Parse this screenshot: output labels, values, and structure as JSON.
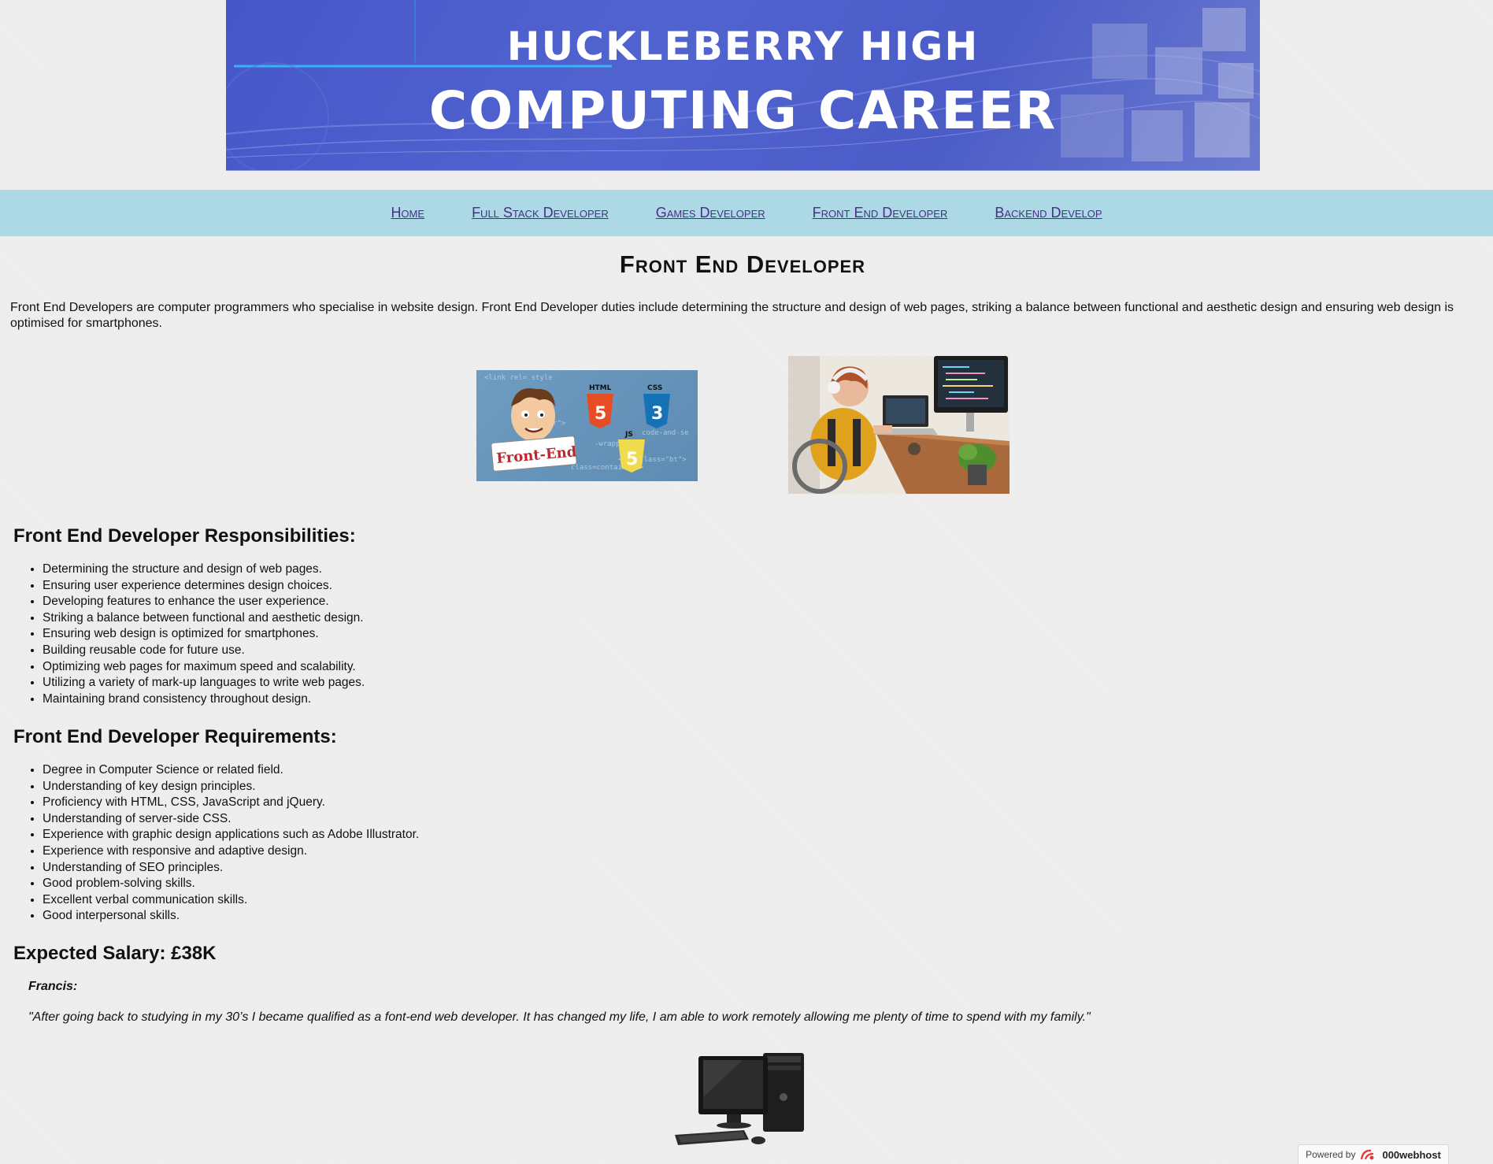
{
  "banner": {
    "line1": "HUCKLEBERRY HIGH",
    "line2": "COMPUTING CAREER",
    "colors": {
      "background": "#4b5cc7",
      "text": "#ffffff"
    }
  },
  "nav": {
    "items": [
      {
        "label": "Home"
      },
      {
        "label": "Full Stack Developer"
      },
      {
        "label": "Games Developer"
      },
      {
        "label": "Front End Developer"
      },
      {
        "label": "Backend Develop"
      }
    ],
    "colors": {
      "background": "#add8e6",
      "link": "#2c2ca0",
      "visited": "#4a2e86"
    }
  },
  "page": {
    "title": "Front End Developer",
    "intro": "Front End Developers are computer programmers who specialise in website design. Front End Developer duties include determining the structure and design of web pages, striking a balance between functional and aesthetic design and ensuring web design is optimised for smartphones."
  },
  "images": {
    "frontend": {
      "badge_text": "Front-End",
      "html_label": "HTML",
      "css_label": "CSS",
      "js_label": "JS",
      "html_num": "5",
      "css_num": "3",
      "js_num": "5",
      "code_lines": [
        "<link rel= style",
        "banner\">",
        "-wrapper\">",
        "class=container\">",
        "<div class=\"bt\">",
        "code-and-se"
      ]
    },
    "developer_photo": {
      "icon": "developer-at-desk-photo"
    },
    "computer": {
      "icon": "desktop-computer-icon"
    }
  },
  "responsibilities": {
    "heading": "Front End Developer Responsibilities:",
    "items": [
      "Determining the structure and design of web pages.",
      "Ensuring user experience determines design choices.",
      "Developing features to enhance the user experience.",
      "Striking a balance between functional and aesthetic design.",
      "Ensuring web design is optimized for smartphones.",
      "Building reusable code for future use.",
      "Optimizing web pages for maximum speed and scalability.",
      "Utilizing a variety of mark-up languages to write web pages.",
      "Maintaining brand consistency throughout design."
    ]
  },
  "requirements": {
    "heading": "Front End Developer Requirements:",
    "items": [
      "Degree in Computer Science or related field.",
      "Understanding of key design principles.",
      "Proficiency with HTML, CSS, JavaScript and jQuery.",
      "Understanding of server-side CSS.",
      "Experience with graphic design applications such as Adobe Illustrator.",
      "Experience with responsive and adaptive design.",
      "Understanding of SEO principles.",
      "Good problem-solving skills.",
      "Excellent verbal communication skills.",
      "Good interpersonal skills."
    ]
  },
  "salary": {
    "heading": "Expected Salary: £38K"
  },
  "testimonial": {
    "name": "Francis:",
    "quote": "\"After going back to studying in my 30’s I became qualified as a font-end web developer. It has changed my life, I am able to work remotely allowing me plenty of time to spend with my family.\""
  },
  "footer": {
    "powered_label": "Powered by",
    "brand": "000webhost",
    "icon": "000webhost-logo-icon"
  }
}
